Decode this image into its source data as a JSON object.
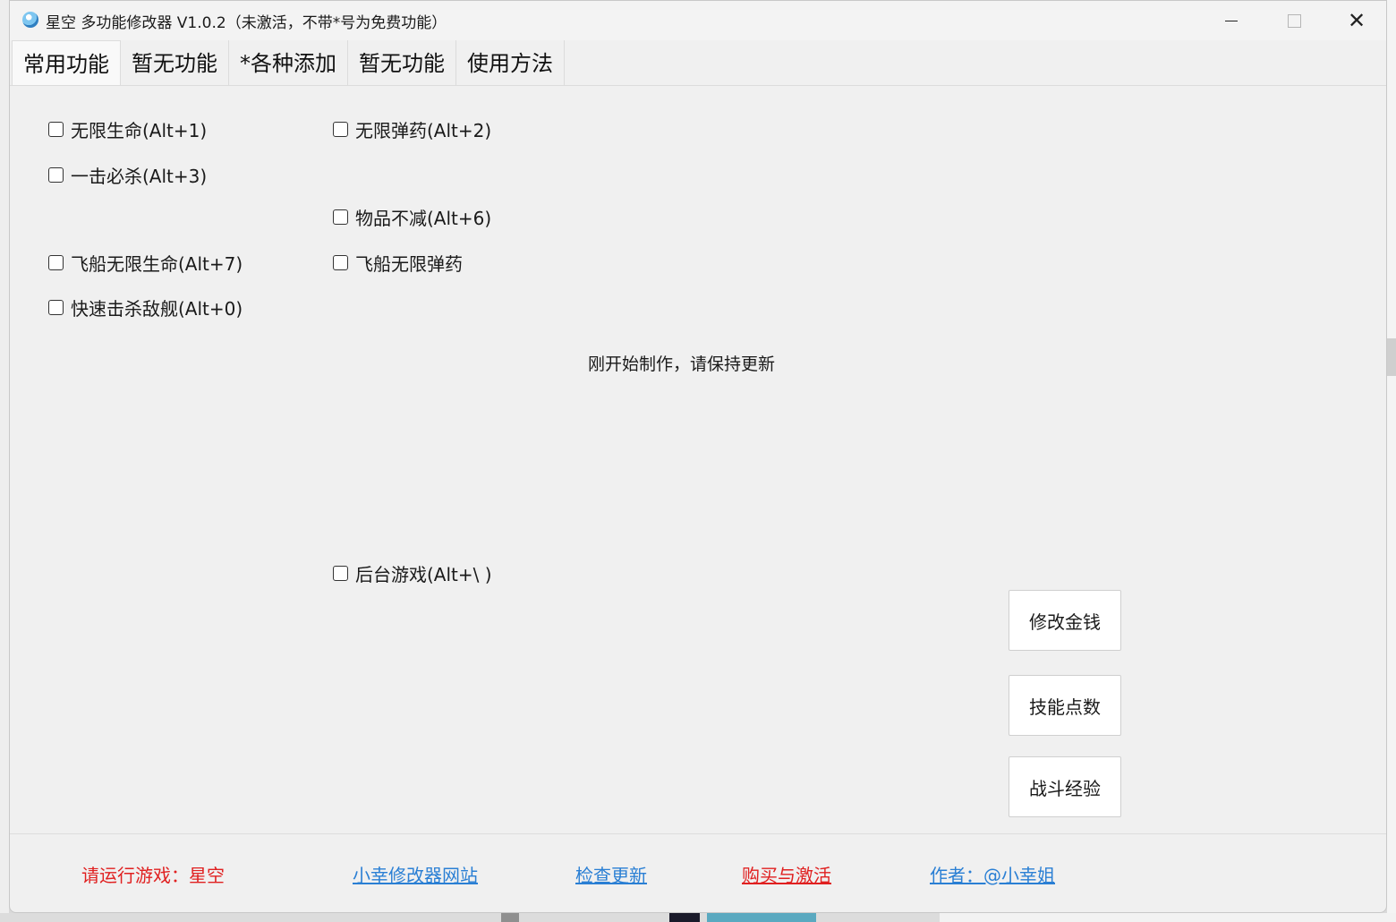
{
  "window": {
    "title": "星空 多功能修改器  V1.0.2（未激活，不带*号为免费功能）",
    "controls": {
      "minimize": "minimize-icon",
      "maximize": "maximize-icon",
      "close": "close-icon"
    }
  },
  "tabs": [
    {
      "label": "常用功能",
      "active": true
    },
    {
      "label": "暂无功能",
      "active": false
    },
    {
      "label": "*各种添加",
      "active": false
    },
    {
      "label": "暂无功能",
      "active": false
    },
    {
      "label": "使用方法",
      "active": false
    }
  ],
  "options": {
    "infinite_health": {
      "label": "无限生命(Alt+1)",
      "checked": false
    },
    "infinite_ammo": {
      "label": "无限弹药(Alt+2)",
      "checked": false
    },
    "one_hit_kill": {
      "label": "一击必杀(Alt+3)",
      "checked": false
    },
    "items_no_decrease": {
      "label": "物品不减(Alt+6)",
      "checked": false
    },
    "ship_infinite_health": {
      "label": "飞船无限生命(Alt+7)",
      "checked": false
    },
    "ship_infinite_ammo": {
      "label": "飞船无限弹药",
      "checked": false
    },
    "fast_kill_enemy_ship": {
      "label": "快速击杀敌舰(Alt+0)",
      "checked": false
    },
    "background_game": {
      "label": "后台游戏(Alt+\\ )",
      "checked": false
    }
  },
  "notice": "刚开始制作，请保持更新",
  "buttons": {
    "modify_money": "修改金钱",
    "skill_points": "技能点数",
    "combat_exp": "战斗经验"
  },
  "footer": {
    "status": "请运行游戏：星空",
    "website": "小幸修改器网站",
    "check_update": "检查更新",
    "buy_activate": "购买与激活",
    "author": "作者：@小幸姐"
  }
}
